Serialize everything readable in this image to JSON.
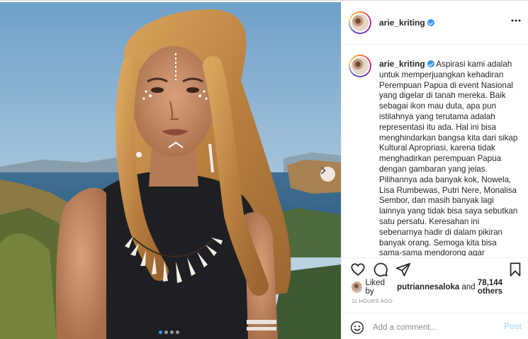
{
  "post": {
    "username": "arie_kriting",
    "verified": true,
    "more_icon": "more-horizontal-icon"
  },
  "media": {
    "next_icon": "chevron-right-icon",
    "carousel_total": 4,
    "carousel_active": 1
  },
  "caption": {
    "username": "arie_kriting",
    "text": "Aspirasi kami adalah untuk memperjuangkan kehadiran Perempuan Papua di event Nasional yang digelar di tanah mereka. Baik sebagai ikon mau duta, apa pun istilahnya yang terutama adalah representasi itu ada. Hal ini bisa menghindarkan bangsa kita dari sikap Kultural Apropriasi, karena tidak menghadirkan perempuan Papua dengan gambaran yang jelas. Pilihannya ada banyak kok, Nowela, Lisa Rumbewas, Putri Nere, Monalisa Sembor, dan masih banyak lagi lainnya yang tidak bisa saya sebutkan satu persatu. Keresahan ini sebenarnya hadir di dalam pikiran banyak orang. Semoga kita bisa sama-sama mendorong agar representasi"
  },
  "actions": {
    "like_icon": "heart-icon",
    "comment_icon": "comment-icon",
    "share_icon": "share-icon",
    "save_icon": "bookmark-icon"
  },
  "likes": {
    "prefix": "Liked by",
    "user": "putriannesaloka",
    "and": "and",
    "count": "78,144 others"
  },
  "timestamp": "11 HOURS AGO",
  "comment": {
    "emoji_icon": "emoji-icon",
    "placeholder": "Add a comment...",
    "post_label": "Post"
  },
  "colors": {
    "verified": "#3897f0",
    "post_button_disabled": "#b2dffc",
    "muted_text": "#8e8e8e"
  }
}
